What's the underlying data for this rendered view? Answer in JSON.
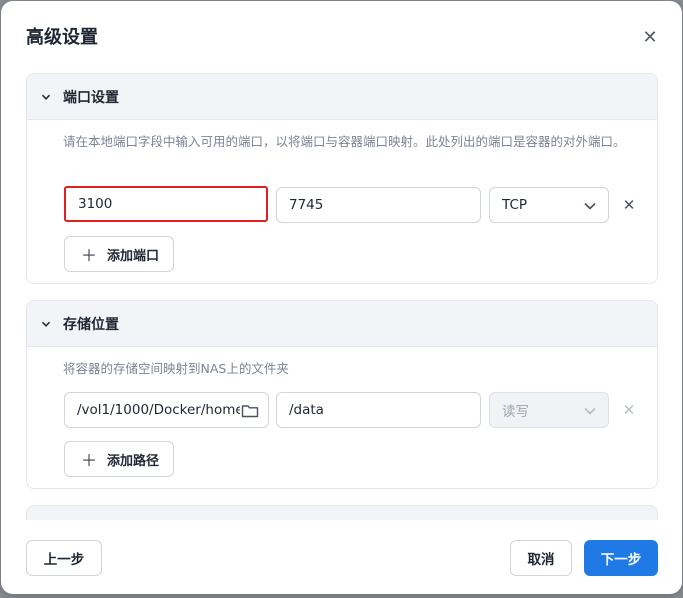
{
  "dialog": {
    "title": "高级设置"
  },
  "ports": {
    "title": "端口设置",
    "description": "请在本地端口字段中输入可用的端口，以将端口与容器端口映射。此处列出的端口是容器的对外端口。",
    "rows": [
      {
        "local_port": "3100",
        "container_port": "7745",
        "protocol": "TCP"
      }
    ],
    "add_label": "添加端口"
  },
  "storage": {
    "title": "存储位置",
    "description": "将容器的存储空间映射到NAS上的文件夹",
    "rows": [
      {
        "host_path": "/vol1/1000/Docker/home",
        "container_path": "/data",
        "mode": "读写"
      }
    ],
    "add_label": "添加路径"
  },
  "footer": {
    "prev_label": "上一步",
    "cancel_label": "取消",
    "next_label": "下一步"
  },
  "colors": {
    "primary": "#1f7ae6",
    "highlight": "#e02020"
  },
  "icons": [
    "close-icon",
    "chevron-down-icon",
    "folder-icon",
    "plus-icon",
    "remove-icon"
  ]
}
